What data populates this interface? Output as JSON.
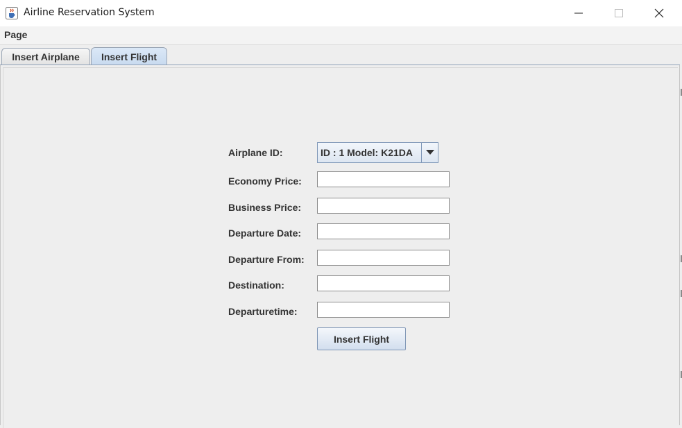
{
  "window": {
    "title": "Airline Reservation System",
    "app_icon": "java-cup-icon",
    "controls": [
      "minimize-icon",
      "maximize-icon",
      "close-icon"
    ]
  },
  "menu": {
    "items": [
      {
        "label": "Page"
      }
    ]
  },
  "tabs": [
    {
      "label": "Insert Airplane",
      "selected": false
    },
    {
      "label": "Insert Flight",
      "selected": true
    }
  ],
  "form": {
    "airplane_id": {
      "label": "Airplane ID:",
      "selected": "ID : 1 Model: K21DA"
    },
    "fields": [
      {
        "label": "Economy Price:",
        "value": ""
      },
      {
        "label": "Business Price:",
        "value": ""
      },
      {
        "label": "Departure Date:",
        "value": ""
      },
      {
        "label": "Departure From:",
        "value": ""
      },
      {
        "label": "Destination:",
        "value": ""
      },
      {
        "label": "Departuretime:",
        "value": ""
      }
    ],
    "submit_label": "Insert Flight"
  },
  "colors": {
    "selected_tab": "#c8daef",
    "accent_border": "#8098b8"
  }
}
